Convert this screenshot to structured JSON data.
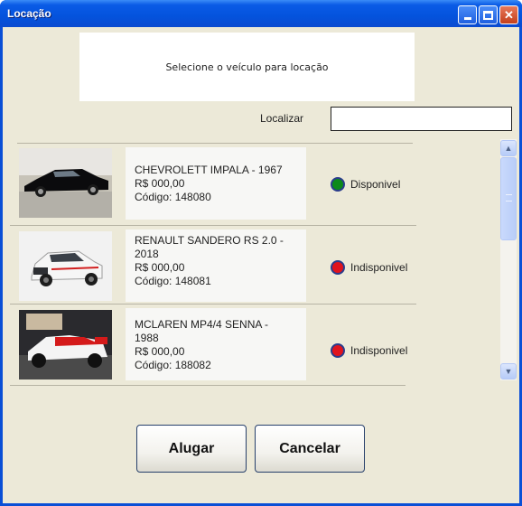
{
  "window": {
    "title": "Locação"
  },
  "header": {
    "instruction": "Selecione o veículo para locação"
  },
  "search": {
    "label": "Localizar",
    "value": "",
    "placeholder": ""
  },
  "vehicles": [
    {
      "name": "CHEVROLETT IMPALA - 1967",
      "name_line2": "",
      "price": " R$ 000,00",
      "code": " Código: 148080",
      "status": "Disponivel",
      "status_color": "#0c8a1a"
    },
    {
      "name": "RENAULT SANDERO RS 2.0 -",
      "name_line2": "2018",
      "price": "R$ 000,00",
      "code": " Código: 148081",
      "status": "Indisponivel",
      "status_color": "#e0141e"
    },
    {
      "name": "MCLAREN MP4/4 SENNA -",
      "name_line2": "1988",
      "price": "R$ 000,00",
      "code": "  Código: 188082",
      "status": "Indisponivel",
      "status_color": "#e0141e"
    }
  ],
  "buttons": {
    "rent": "Alugar",
    "cancel": "Cancelar"
  },
  "colors": {
    "title_bar": "#0453dd",
    "client_bg": "#ece9d8",
    "available": "#0c8a1a",
    "unavailable": "#e0141e"
  }
}
